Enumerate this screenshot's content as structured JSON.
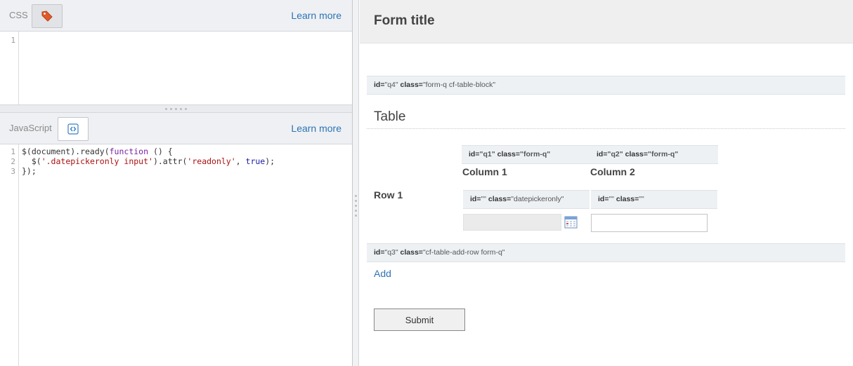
{
  "css_panel": {
    "label": "CSS",
    "learn_more": "Learn more",
    "line_numbers": [
      "1"
    ]
  },
  "js_panel": {
    "label": "JavaScript",
    "learn_more": "Learn more",
    "line_numbers": [
      "1",
      "2",
      "3"
    ],
    "code": {
      "l1_a": "$(document).ready(",
      "l1_kw": "function",
      "l1_b": " () {",
      "l2_a": "  $(",
      "l2_s1": "'.datepickeronly input'",
      "l2_b": ").attr(",
      "l2_s2": "'readonly'",
      "l2_c": ", ",
      "l2_atom": "true",
      "l2_d": ");",
      "l3": "});"
    }
  },
  "preview": {
    "form_title": "Form title",
    "q4_meta": {
      "id_label": "id=",
      "id_value": "\"q4\"",
      "class_label": "class=",
      "class_value": "\"form-q cf-table-block\""
    },
    "table_heading": "Table",
    "q1_meta": {
      "id_label": "id=",
      "id_value": "\"q1\"",
      "class_label": "class=",
      "class_value": "\"form-q\""
    },
    "q2_meta": {
      "id_label": "id=",
      "id_value": "\"q2\"",
      "class_label": "class=",
      "class_value": "\"form-q\""
    },
    "column1": "Column 1",
    "column2": "Column 2",
    "row1": "Row 1",
    "cell1_meta": {
      "id_label": "id=",
      "id_value": "\"\"",
      "class_label": "class=",
      "class_value": "\"datepickeronly\""
    },
    "cell2_meta": {
      "id_label": "id=",
      "id_value": "\"\"",
      "class_label": "class=",
      "class_value": "\"\""
    },
    "q3_meta": {
      "id_label": "id=",
      "id_value": "\"q3\"",
      "class_label": "class=",
      "class_value": "\"cf-table-add-row form-q\""
    },
    "add_link": "Add",
    "submit": "Submit"
  },
  "icons": {
    "css_button": "tag-icon",
    "js_button": "code-brackets-icon",
    "datepicker": "calendar-icon"
  },
  "colors": {
    "accent_link": "#2d74b5",
    "tag_icon": "#e05a2a"
  }
}
